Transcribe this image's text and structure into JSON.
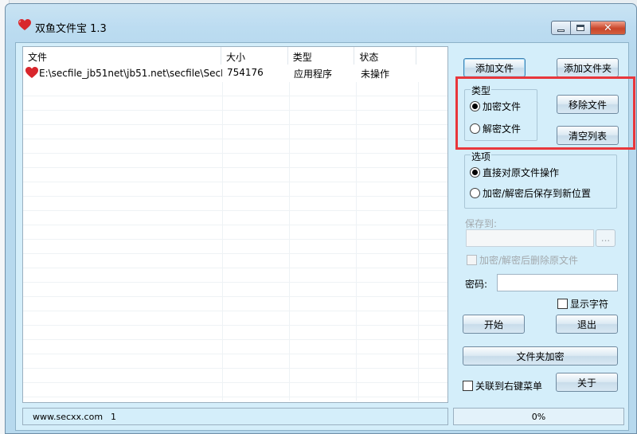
{
  "window": {
    "title": "双鱼文件宝 1.3"
  },
  "file_list": {
    "columns": [
      "文件",
      "大小",
      "类型",
      "状态"
    ],
    "rows": [
      {
        "file": "E:\\secfile_jb51net\\jb51.net\\secfile\\SecFil...",
        "size": "754176",
        "type": "应用程序",
        "status": "未操作"
      }
    ]
  },
  "buttons": {
    "add_file": "添加文件",
    "add_folder": "添加文件夹",
    "remove_file": "移除文件",
    "clear_list": "清空列表",
    "start": "开始",
    "exit": "退出",
    "folder_encrypt": "文件夹加密",
    "about": "关于",
    "browse": "..."
  },
  "type_group": {
    "label": "类型",
    "options": [
      {
        "label": "加密文件",
        "selected": true
      },
      {
        "label": "解密文件",
        "selected": false
      }
    ]
  },
  "options_group": {
    "label": "选项",
    "options": [
      {
        "label": "直接对原文件操作",
        "selected": true
      },
      {
        "label": "加密/解密后保存到新位置",
        "selected": false
      }
    ]
  },
  "save_to": {
    "label": "保存到:",
    "value": ""
  },
  "delete_original": {
    "label": "加密/解密后删除原文件",
    "checked": false,
    "enabled": false
  },
  "password": {
    "label": "密码:",
    "value": ""
  },
  "show_chars": {
    "label": "显示字符",
    "checked": false
  },
  "context_menu": {
    "label": "关联到右键菜单",
    "checked": false
  },
  "status": {
    "website": "www.secxx.com",
    "count": "1",
    "progress": "0%"
  },
  "colors": {
    "highlight_box": "#e8373c",
    "client_bg": "#d4eefa"
  }
}
